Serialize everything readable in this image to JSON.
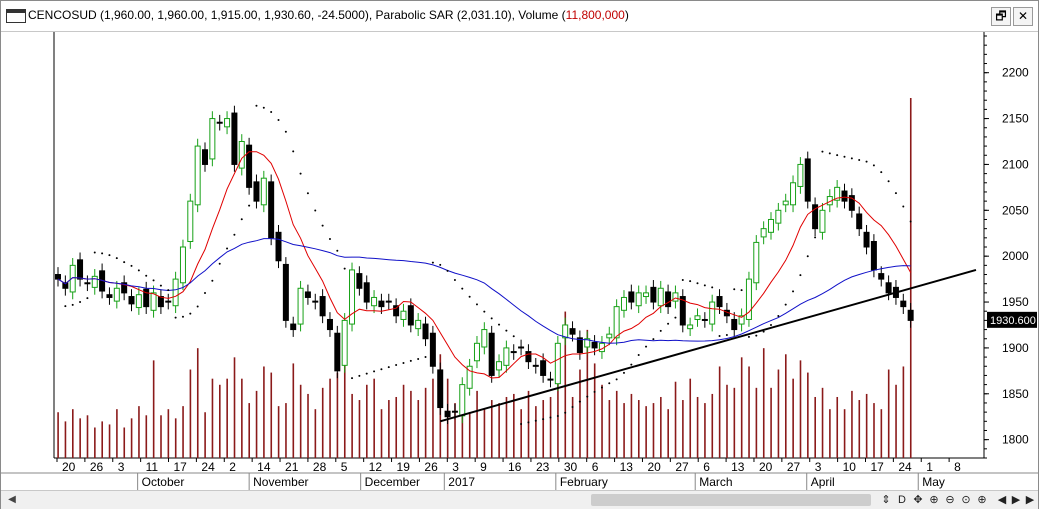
{
  "window": {
    "title_prefix": "CENCOSUD (1,960.00, 1,960.00, 1,915.00, 1,930.60, -24.5000), Parabolic SAR (2,031.10), Volume (",
    "title_volume": "11,800,000",
    "title_suffix": ")",
    "restore_glyph": "🗗",
    "close_glyph": "✕"
  },
  "colors": {
    "up": "#17a117",
    "down": "#000000",
    "volume": "#8b1a1a",
    "ma_short": "#e00000",
    "ma_long": "#1010c8",
    "sar": "#000000",
    "trendline": "#000000"
  },
  "chart_data": {
    "type": "candlestick",
    "symbol": "CENCOSUD",
    "last_price_label": "1930.600",
    "ylim": [
      1780,
      2240
    ],
    "y_ticks": [
      1800,
      1850,
      1900,
      1950,
      2000,
      2050,
      2100,
      2150,
      2200
    ],
    "x_ticks": [
      {
        "label": "20"
      },
      {
        "label": "26"
      },
      {
        "label": "3"
      },
      {
        "label": "11"
      },
      {
        "label": "17"
      },
      {
        "label": "24"
      },
      {
        "label": "2"
      },
      {
        "label": "14"
      },
      {
        "label": "21"
      },
      {
        "label": "28"
      },
      {
        "label": "5"
      },
      {
        "label": "12"
      },
      {
        "label": "19"
      },
      {
        "label": "26"
      },
      {
        "label": "3"
      },
      {
        "label": "9"
      },
      {
        "label": "16"
      },
      {
        "label": "23"
      },
      {
        "label": "30"
      },
      {
        "label": "6"
      },
      {
        "label": "13"
      },
      {
        "label": "20"
      },
      {
        "label": "27"
      },
      {
        "label": "6"
      },
      {
        "label": "13"
      },
      {
        "label": "20"
      },
      {
        "label": "27"
      },
      {
        "label": "3"
      },
      {
        "label": "10"
      },
      {
        "label": "17"
      },
      {
        "label": "24"
      },
      {
        "label": "1"
      },
      {
        "label": "8"
      }
    ],
    "month_labels": [
      {
        "label": "October"
      },
      {
        "label": "November"
      },
      {
        "label": "December"
      },
      {
        "label": "2017"
      },
      {
        "label": "February"
      },
      {
        "label": "March"
      },
      {
        "label": "April"
      },
      {
        "label": "May"
      }
    ],
    "close": [
      1975,
      1965,
      1990,
      1975,
      1970,
      1978,
      1962,
      1955,
      1965,
      1960,
      1948,
      1958,
      1945,
      1960,
      1945,
      1950,
      1975,
      2010,
      2060,
      2120,
      2100,
      2150,
      2145,
      2150,
      2100,
      2125,
      2075,
      2060,
      2085,
      2020,
      1995,
      1930,
      1920,
      1965,
      1955,
      1950,
      1935,
      1920,
      1875,
      1930,
      1985,
      1965,
      1950,
      1955,
      1945,
      1950,
      1935,
      1940,
      1925,
      1930,
      1910,
      1880,
      1835,
      1825,
      1830,
      1860,
      1880,
      1905,
      1920,
      1870,
      1885,
      1900,
      1895,
      1900,
      1885,
      1880,
      1870,
      1865,
      1905,
      1925,
      1915,
      1895,
      1910,
      1900,
      1905,
      1915,
      1945,
      1955,
      1950,
      1960,
      1960,
      1950,
      1965,
      1945,
      1960,
      1925,
      1925,
      1935,
      1930,
      1950,
      1945,
      1935,
      1920,
      1935,
      1975,
      2015,
      2030,
      2040,
      2050,
      2060,
      2080,
      2100,
      2060,
      2030,
      2050,
      2065,
      2075,
      2060,
      2050,
      2030,
      2010,
      1985,
      1975,
      1960,
      1955,
      1945,
      1930
    ],
    "volume": [
      1.5,
      1.2,
      1.6,
      1.3,
      1.4,
      1.0,
      1.2,
      1.1,
      1.6,
      1.0,
      1.3,
      1.7,
      1.4,
      3.2,
      1.4,
      1.6,
      1.3,
      1.7,
      2.9,
      3.6,
      1.5,
      2.6,
      2.4,
      2.6,
      3.3,
      2.6,
      1.8,
      2.2,
      3.0,
      2.8,
      1.7,
      1.8,
      3.1,
      2.4,
      2.1,
      1.6,
      2.3,
      2.6,
      2.8,
      3.4,
      2.1,
      1.9,
      2.4,
      2.6,
      1.6,
      1.9,
      2.0,
      2.4,
      2.2,
      1.9,
      2.3,
      2.6,
      3.4,
      2.6,
      1.8,
      2.0,
      1.5,
      2.2,
      1.6,
      1.9,
      1.8,
      2.0,
      2.1,
      1.6,
      2.2,
      1.7,
      1.9,
      2.0,
      2.8,
      4.8,
      2.0,
      2.9,
      4.2,
      3.1,
      2.4,
      1.9,
      2.2,
      1.8,
      2.1,
      1.9,
      1.7,
      1.8,
      2.0,
      1.6,
      2.5,
      1.9,
      2.6,
      2.0,
      1.8,
      2.1,
      3.0,
      2.4,
      2.3,
      3.3,
      3.0,
      2.3,
      3.6,
      2.3,
      2.9,
      3.4,
      2.6,
      3.2,
      2.8,
      2.0,
      2.3,
      1.6,
      2.0,
      1.6,
      2.2,
      1.9,
      2.1,
      1.8,
      1.6,
      2.9,
      2.4,
      3.0,
      11.8
    ]
  }
}
